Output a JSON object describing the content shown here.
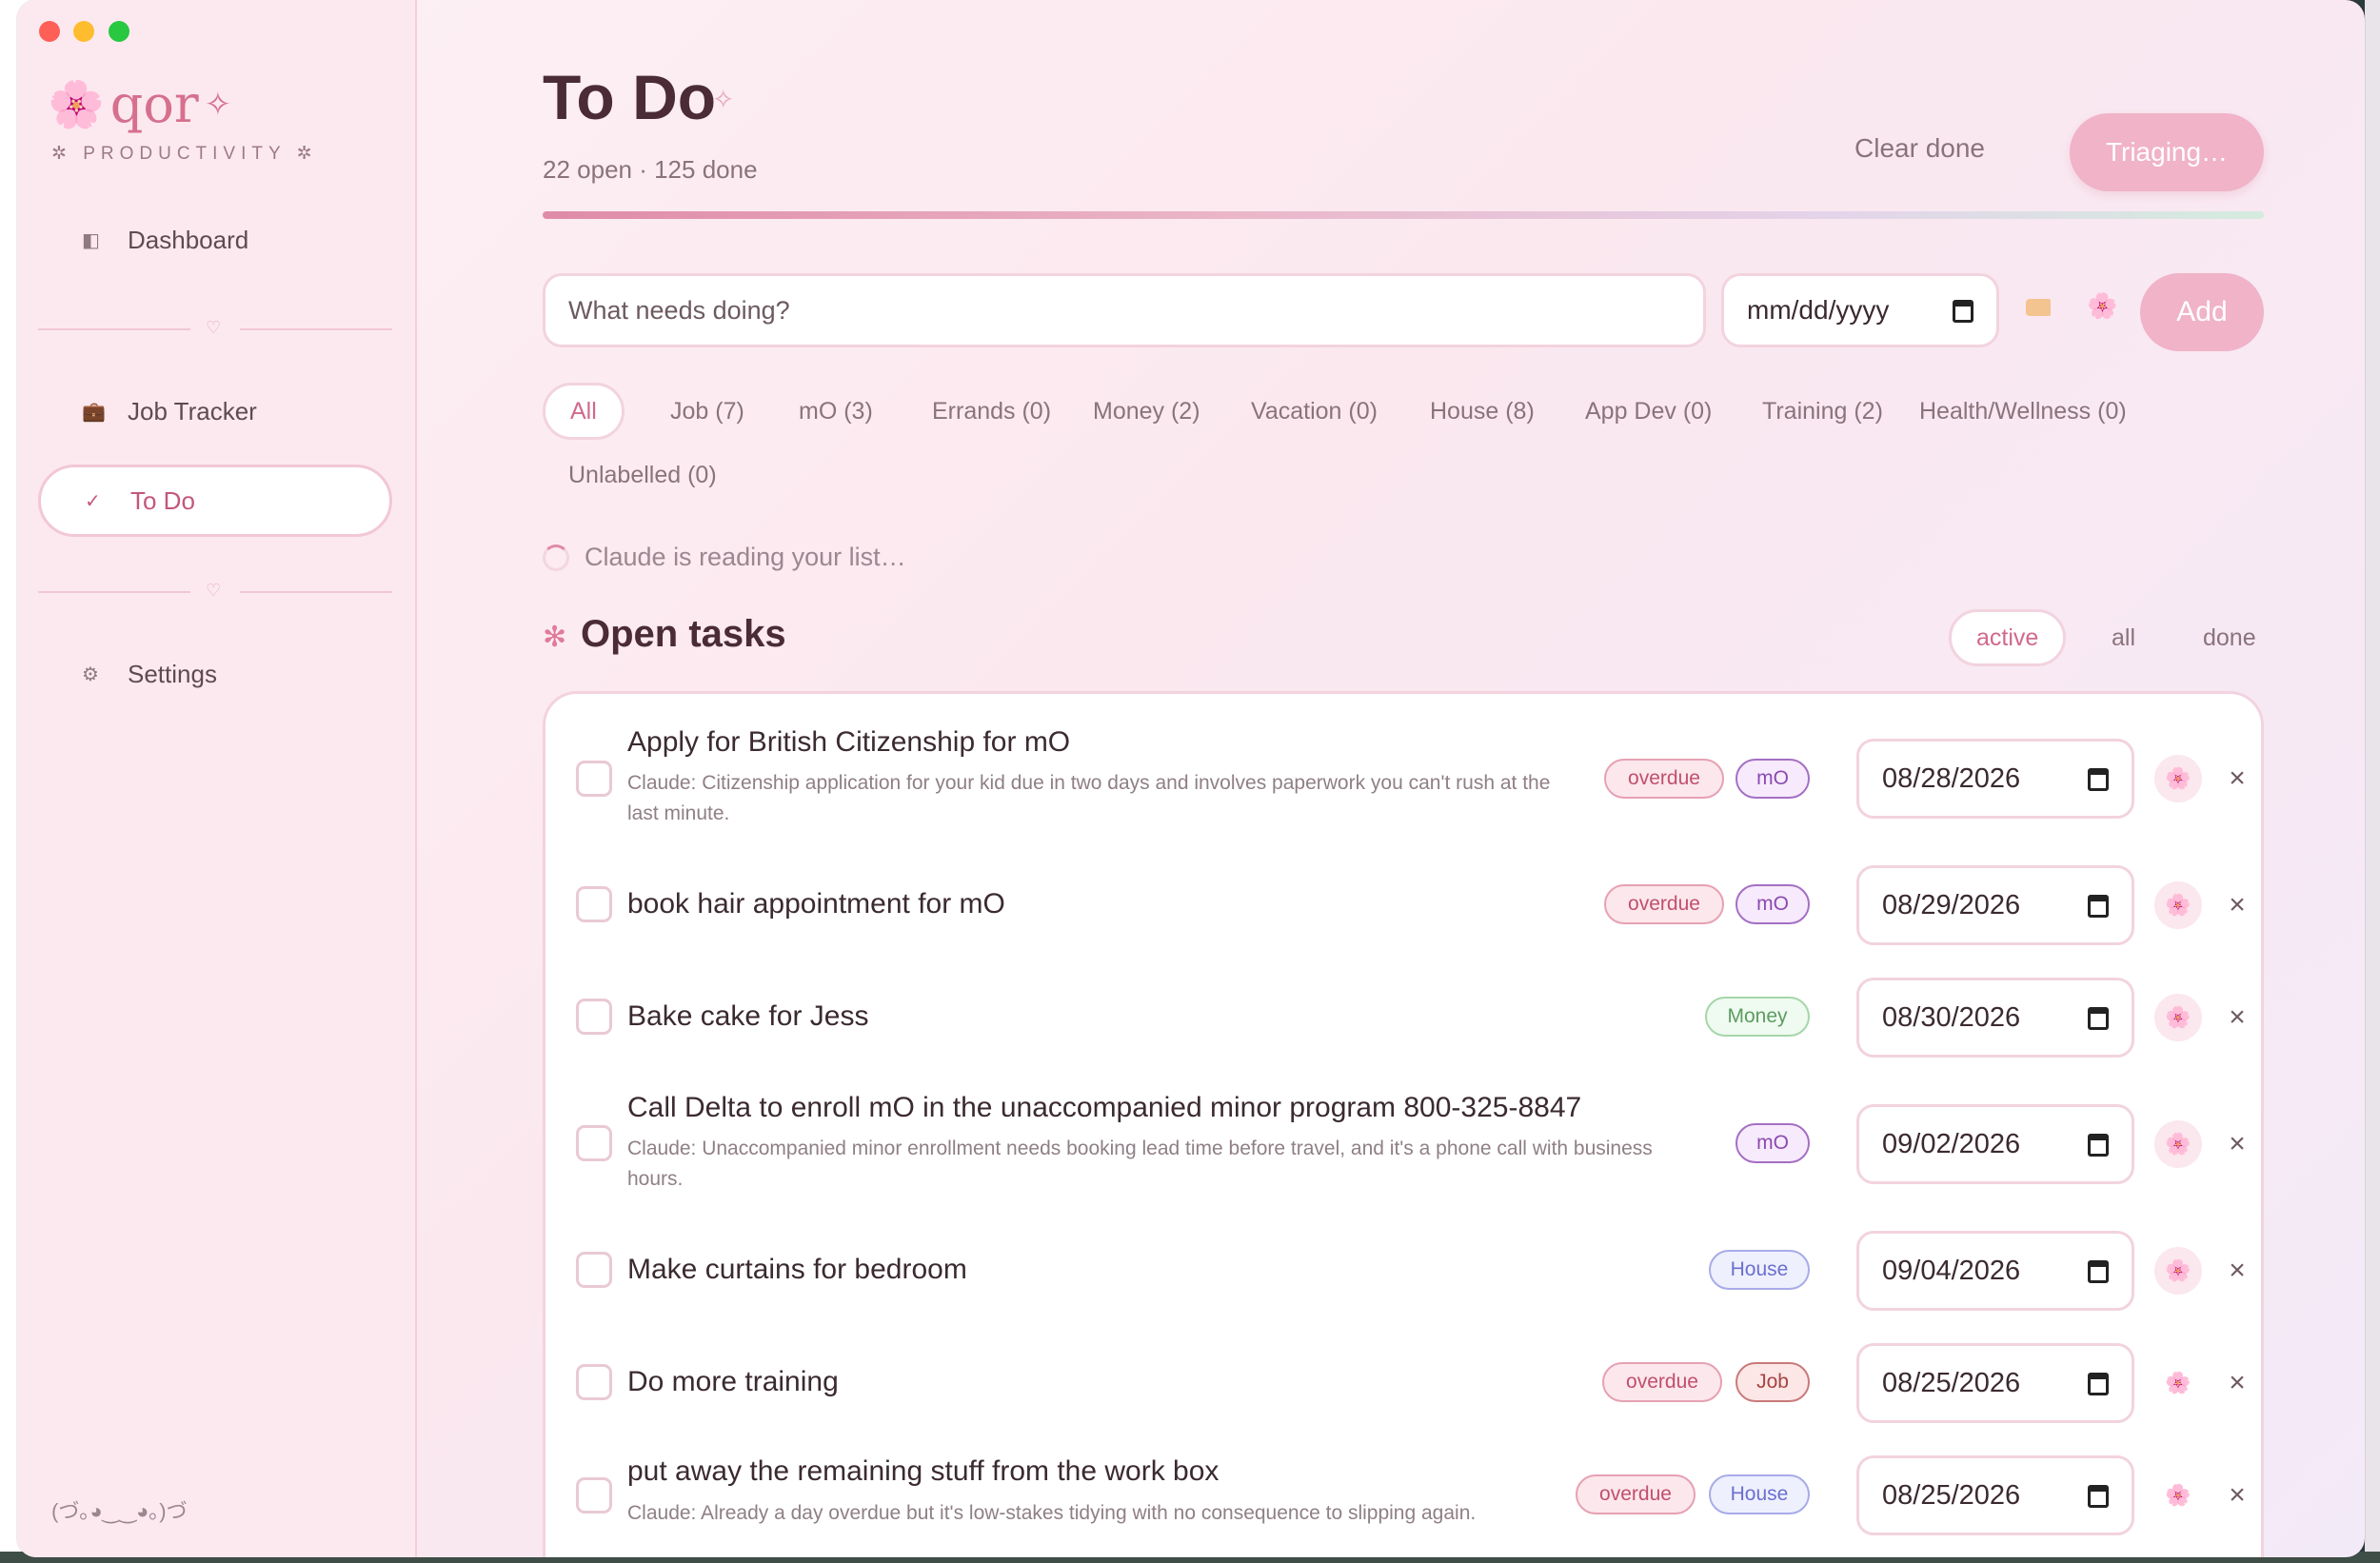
{
  "app": {
    "brand_name": "qor",
    "tagline": "✲ PRODUCTIVITY ✲",
    "kaomoji": "(づ｡◕‿‿◕｡)づ"
  },
  "sidebar": {
    "items": [
      {
        "label": "Dashboard",
        "icon": "dashboard-icon",
        "active": false
      },
      {
        "label": "Job Tracker",
        "icon": "briefcase-icon",
        "active": false
      },
      {
        "label": "To Do",
        "icon": "check-icon",
        "active": true
      },
      {
        "label": "Settings",
        "icon": "gear-icon",
        "active": false
      }
    ]
  },
  "header": {
    "title": "To Do",
    "subtitle": "22 open · 125 done",
    "clear_done_label": "Clear done",
    "triage_label": "Triaging…"
  },
  "new_task": {
    "placeholder": "What needs doing?",
    "date_placeholder": "mm/dd/yyyy",
    "add_label": "Add"
  },
  "filters": [
    {
      "label": "All",
      "active": true
    },
    {
      "label": "Job (7)"
    },
    {
      "label": "mO (3)"
    },
    {
      "label": "Errands (0)"
    },
    {
      "label": "Money (2)"
    },
    {
      "label": "Vacation (0)"
    },
    {
      "label": "House (8)"
    },
    {
      "label": "App Dev (0)"
    },
    {
      "label": "Training (2)"
    },
    {
      "label": "Health/Wellness (0)"
    },
    {
      "label": "Unlabelled (0)"
    }
  ],
  "status": {
    "claude_text": "Claude is reading your list…"
  },
  "section": {
    "title": "Open tasks",
    "views": [
      "active",
      "all",
      "done"
    ],
    "active_view": "active"
  },
  "tasks": [
    {
      "title": "Apply for British Citizenship for mO",
      "note": "Claude: Citizenship application for your kid due in two days and involves paperwork you can't rush at the last minute.",
      "overdue_label": "overdue",
      "tag": "mO",
      "date": "08/28/2026"
    },
    {
      "title": "book hair appointment for mO",
      "note": "",
      "overdue_label": "overdue",
      "tag": "mO",
      "date": "08/29/2026"
    },
    {
      "title": "Bake cake for Jess",
      "note": "",
      "overdue_label": "",
      "tag": "Money",
      "date": "08/30/2026"
    },
    {
      "title": "Call Delta to enroll mO in the unaccompanied minor program 800-325-8847",
      "note": "Claude: Unaccompanied minor enrollment needs booking lead time before travel, and it's a phone call with business hours.",
      "overdue_label": "",
      "tag": "mO",
      "date": "09/02/2026"
    },
    {
      "title": "Make curtains for bedroom",
      "note": "",
      "overdue_label": "",
      "tag": "House",
      "date": "09/04/2026"
    },
    {
      "title": "Do more training",
      "note": "",
      "overdue_label": "overdue",
      "tag": "Job",
      "date": "08/25/2026"
    },
    {
      "title": "put away the remaining stuff from the work box",
      "note": "Claude: Already a day overdue but it's low-stakes tidying with no consequence to slipping again.",
      "overdue_label": "overdue",
      "tag": "House",
      "date": "08/25/2026"
    }
  ],
  "colors": {
    "accent": "#d6708f",
    "button_pink": "#f0b3c8",
    "overdue": "#c14f6e",
    "tag_mO": "#8a4bb0",
    "tag_money": "#5d9c61",
    "tag_house": "#6b6fd0",
    "tag_job": "#a84343"
  }
}
